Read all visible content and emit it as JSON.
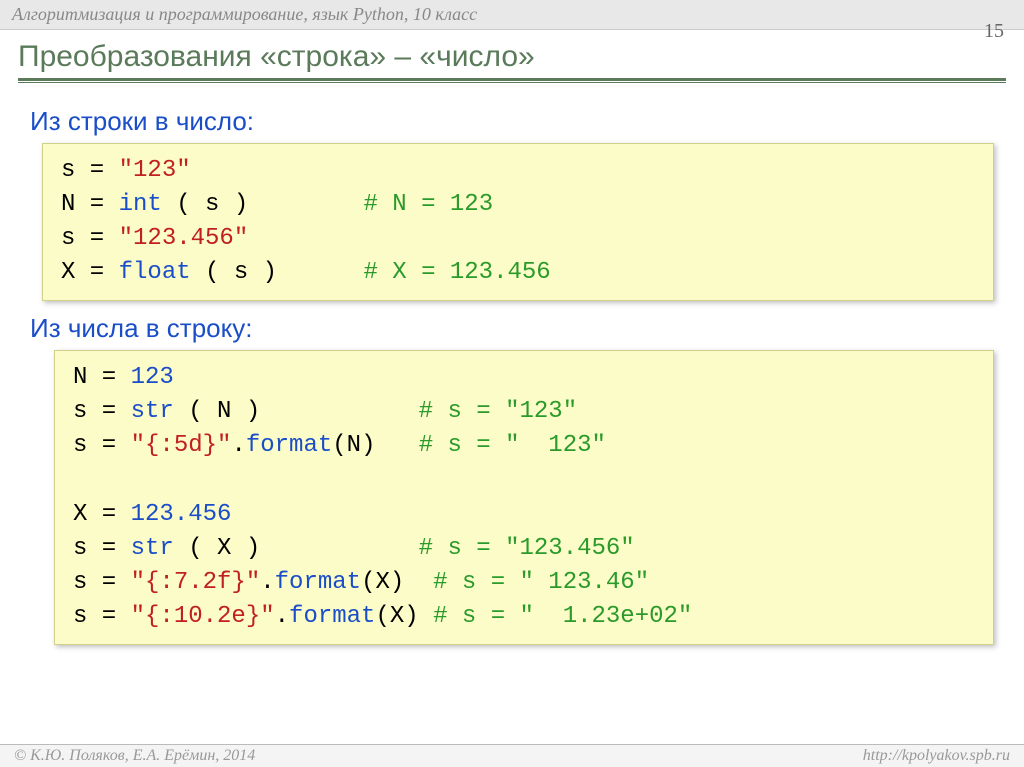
{
  "header": "Алгоритмизация и программирование, язык Python, 10 класс",
  "page_number": "15",
  "title": "Преобразования «строка» – «число»",
  "section1": "Из строки в число:",
  "section2": "Из числа в строку:",
  "code1": {
    "l1a": "s = ",
    "l1b": "\"123\"",
    "l2a": "N = ",
    "l2b": "int",
    "l2c": " ( s )        ",
    "l2d": "# N = 123",
    "l3a": "s = ",
    "l3b": "\"123.456\"",
    "l4a": "X = ",
    "l4b": "float",
    "l4c": " ( s )      ",
    "l4d": "# X = 123.456"
  },
  "code2": {
    "l1a": "N = ",
    "l1b": "123",
    "l2a": "s = ",
    "l2b": "str",
    "l2c": " ( N )           ",
    "l2d": "# s = \"123\"",
    "l3a": "s = ",
    "l3b": "\"{:5d}\"",
    "l3c": ".",
    "l3d": "format",
    "l3e": "(N)   ",
    "l3f": "# s = \"  123\"",
    "l4a": "X = ",
    "l4b": "123.456",
    "l5a": "s = ",
    "l5b": "str",
    "l5c": " ( X )           ",
    "l5d": "# s = \"123.456\"",
    "l6a": "s = ",
    "l6b": "\"{:7.2f}\"",
    "l6c": ".",
    "l6d": "format",
    "l6e": "(X)  ",
    "l6f": "# s = \" 123.46\"",
    "l7a": "s = ",
    "l7b": "\"{:10.2e}\"",
    "l7c": ".",
    "l7d": "format",
    "l7e": "(X) ",
    "l7f": "# s = \"  1.23e+02\""
  },
  "footer_left": "© К.Ю. Поляков, Е.А. Ерёмин, 2014",
  "footer_right": "http://kpolyakov.spb.ru"
}
